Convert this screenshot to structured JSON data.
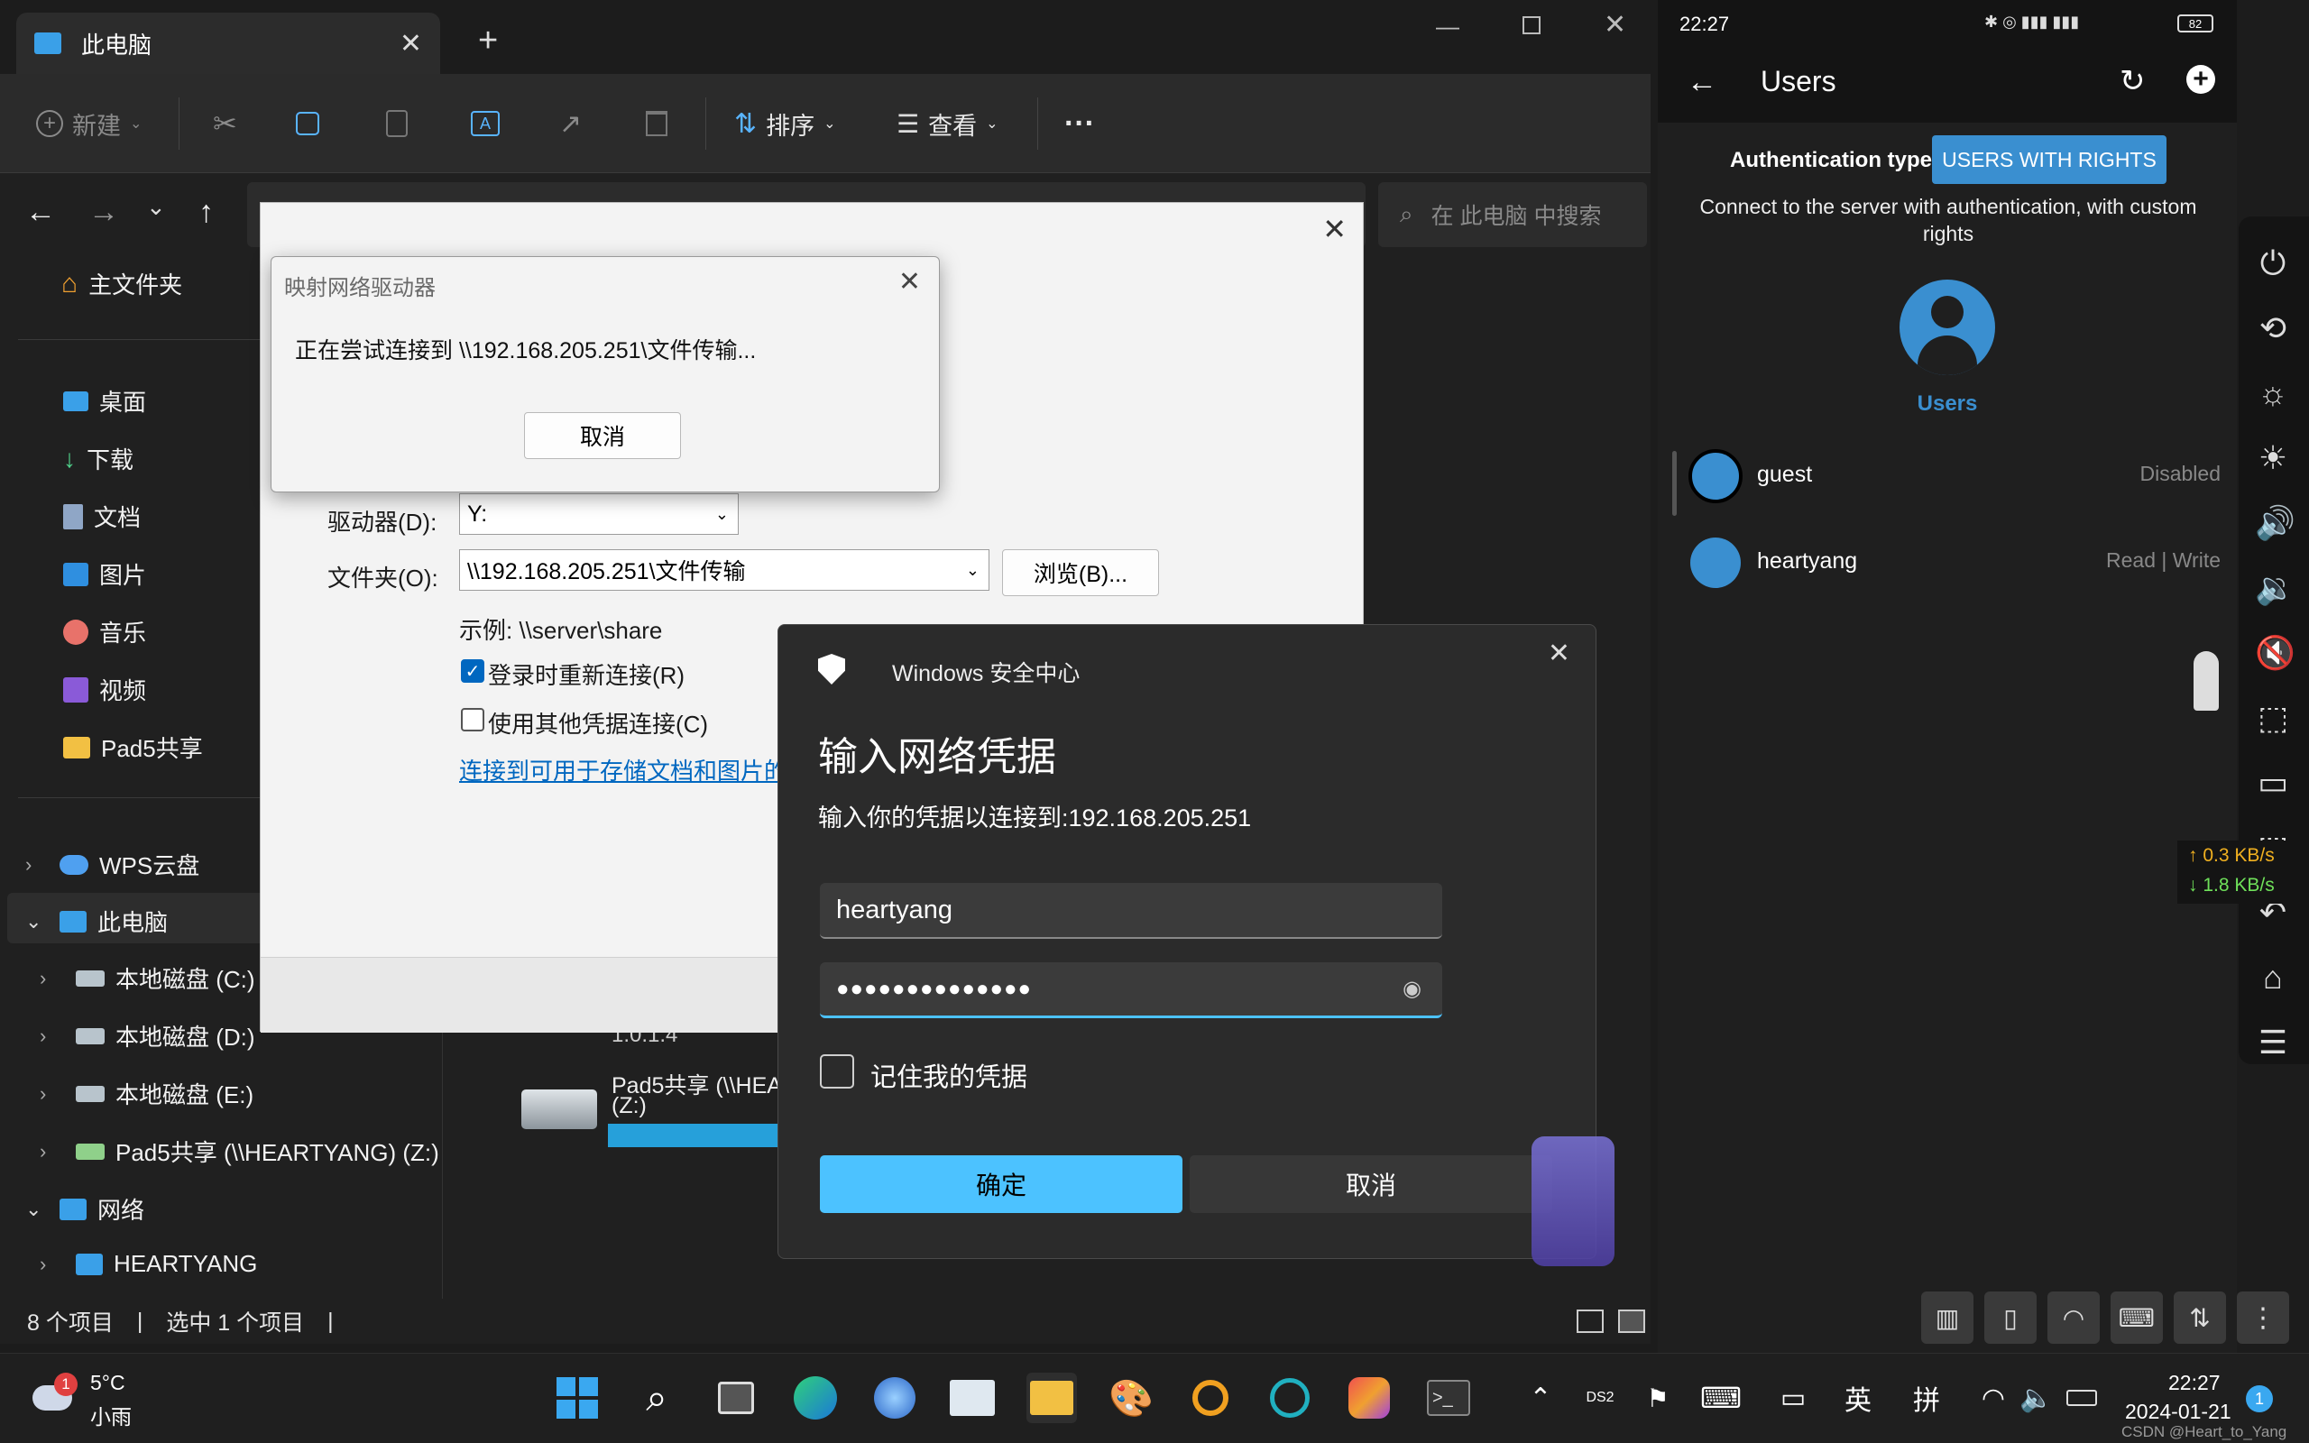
{
  "explorer": {
    "tab_title": "此电脑",
    "new_tab": "+",
    "toolbar": {
      "new": "新建",
      "sort": "排序",
      "view": "查看",
      "more": "···"
    },
    "search_placeholder": "在 此电脑 中搜索",
    "sidebar": {
      "home": "主文件夹",
      "quick": [
        "桌面",
        "下载",
        "文档",
        "图片",
        "音乐",
        "视频",
        "Pad5共享"
      ],
      "wps": "WPS云盘",
      "this_pc": "此电脑",
      "drives": [
        "本地磁盘 (C:)",
        "本地磁盘 (D:)",
        "本地磁盘 (E:)",
        "Pad5共享 (\\\\HEARTYANG) (Z:)"
      ],
      "network": "网络",
      "heartyang": "HEARTYANG"
    },
    "content": {
      "version": "1.0.1.4",
      "drive_name": "Pad5共享 (\\\\HEA",
      "drive_letter": "(Z:)"
    },
    "status": {
      "count": "8 个项目",
      "selected": "选中 1 个项目"
    }
  },
  "map_dialog": {
    "drive_label": "驱动器(D):",
    "drive_value": "Y:",
    "folder_label": "文件夹(O):",
    "folder_value": "\\\\192.168.205.251\\文件传输",
    "browse": "浏览(B)...",
    "example": "示例: \\\\server\\share",
    "reconnect": "登录时重新连接(R)",
    "other_cred": "使用其他凭据连接(C)",
    "link": "连接到可用于存储文档和图片的网"
  },
  "connecting_dialog": {
    "title": "映射网络驱动器",
    "message": "正在尝试连接到 \\\\192.168.205.251\\文件传输...",
    "cancel": "取消"
  },
  "security_dialog": {
    "app": "Windows 安全中心",
    "heading": "输入网络凭据",
    "subtitle": "输入你的凭据以连接到:192.168.205.251",
    "username": "heartyang",
    "password": "●●●●●●●●●●●●●●",
    "remember": "记住我的凭据",
    "ok": "确定",
    "cancel": "取消"
  },
  "phone": {
    "time": "22:27",
    "battery": "82",
    "title": "Users",
    "auth_label": "Authentication type",
    "auth_value": "USERS WITH RIGHTS",
    "description": "Connect to the server with authentication, with custom rights",
    "avatar_label": "Users",
    "users": [
      {
        "name": "guest",
        "status": "Disabled"
      },
      {
        "name": "heartyang",
        "status": "Read | Write"
      }
    ],
    "net_up": "↑ 0.3 KB/s",
    "net_down": "↓ 1.8 KB/s",
    "accent": "#3a8fd0"
  },
  "taskbar": {
    "temp": "5°C",
    "weather": "小雨",
    "weather_badge": "1",
    "ime_lang": "英",
    "ime_mode": "拼",
    "time": "22:27",
    "date": "2024-01-21",
    "notif": "1",
    "watermark": "CSDN @Heart_to_Yang"
  }
}
